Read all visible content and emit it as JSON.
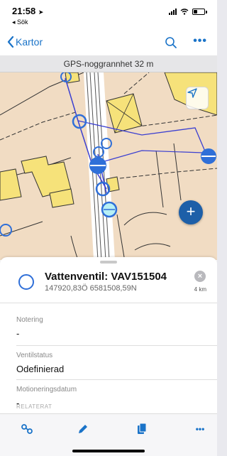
{
  "status_bar": {
    "time": "21:58",
    "back_app": "◂ Sök"
  },
  "nav_bar": {
    "back_label": "Kartor",
    "more_label": "•••"
  },
  "gps_banner": {
    "text": "GPS-noggrannhet 32 m"
  },
  "colors": {
    "accent": "#1a73c8",
    "fab": "#1d5fa8",
    "map_background": "#f1dcc3",
    "building": "#f6e27a",
    "valve_symbol": "#2f6fd8",
    "pipe_line": "#3b3fd1"
  },
  "feature": {
    "title": "Vattenventil: VAV151504",
    "coordinates": "147920,83Ö 6581508,59N",
    "distance": "4 km",
    "close_label": "×"
  },
  "attributes": [
    {
      "label": "Notering",
      "value": "-"
    },
    {
      "label": "Ventilstatus",
      "value": "Odefinierad"
    },
    {
      "label": "Motioneringsdatum",
      "value": "-"
    }
  ],
  "related_section": {
    "title": "RELATERAT"
  },
  "toolbar": {
    "more_label": "•••"
  },
  "map": {
    "add_label": "+"
  }
}
